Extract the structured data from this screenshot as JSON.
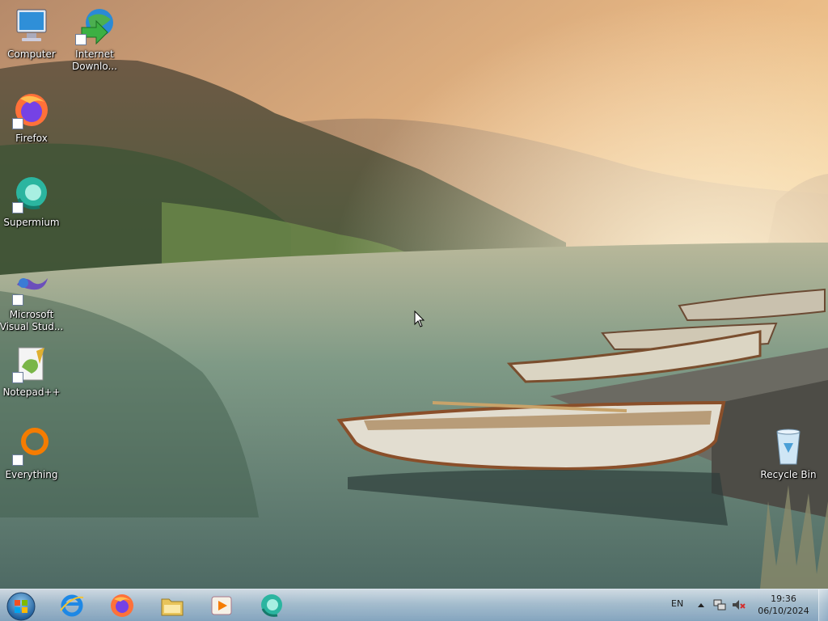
{
  "desktop": {
    "icons": [
      {
        "label": "Computer",
        "icon": "computer-icon"
      },
      {
        "label": "Internet\nDownlo...",
        "icon": "internet-download-manager-icon"
      },
      {
        "label": "Firefox",
        "icon": "firefox-icon"
      },
      {
        "label": "Supermium",
        "icon": "supermium-icon"
      },
      {
        "label": "Microsoft\nVisual Stud...",
        "icon": "visual-studio-icon"
      },
      {
        "label": "Notepad++",
        "icon": "notepad-plus-plus-icon"
      },
      {
        "label": "Everything",
        "icon": "everything-search-icon"
      },
      {
        "label": "Recycle Bin",
        "icon": "recycle-bin-icon"
      }
    ]
  },
  "taskbar": {
    "pinned": [
      {
        "name": "internet-explorer",
        "icon": "internet-explorer-icon"
      },
      {
        "name": "firefox",
        "icon": "firefox-icon"
      },
      {
        "name": "file-explorer",
        "icon": "folder-icon"
      },
      {
        "name": "media-player",
        "icon": "media-player-icon"
      },
      {
        "name": "supermium",
        "icon": "supermium-icon"
      }
    ],
    "tray": {
      "language": "EN",
      "time": "19:36",
      "date": "06/10/2024",
      "icons": [
        "show-hidden-icons-arrow",
        "network-icon",
        "volume-muted-icon"
      ]
    }
  },
  "colors": {
    "sky": "#f2c48a",
    "water": "#6f8a78",
    "taskbar": "#9dbad6"
  }
}
